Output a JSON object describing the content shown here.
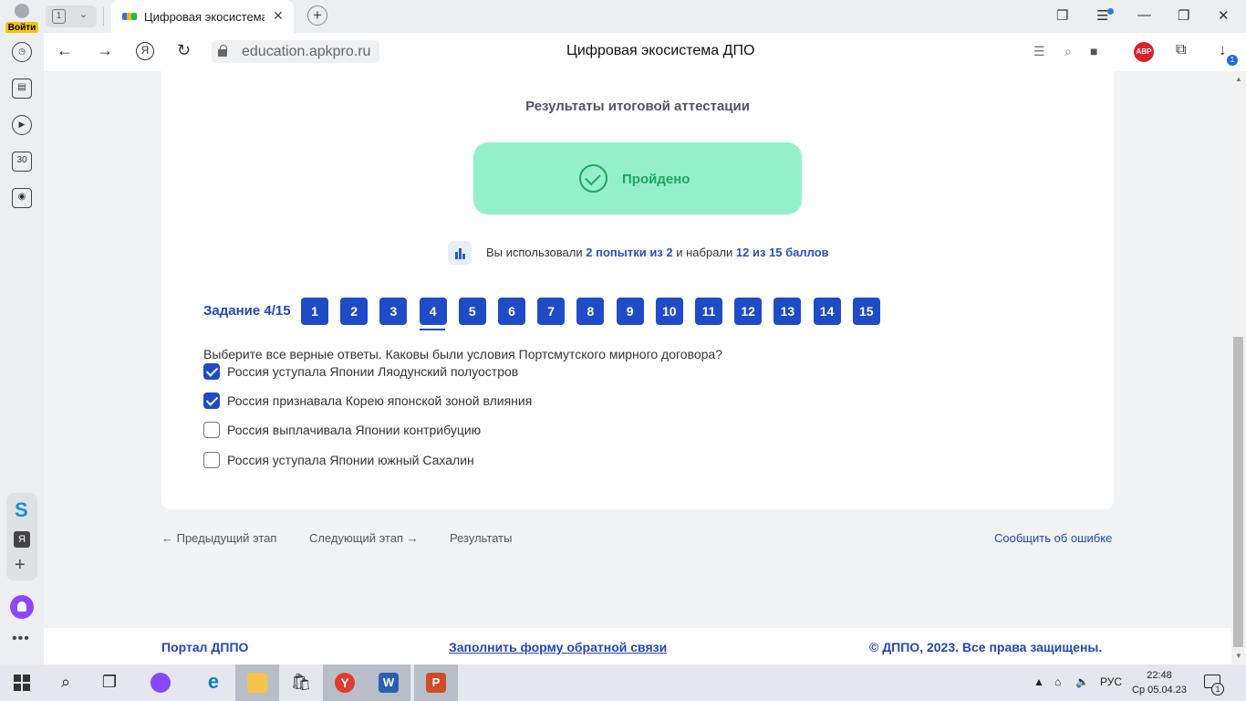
{
  "browser": {
    "login_label": "Войти",
    "tab_count": "1",
    "tab_title": "Цифровая экосистема ДПО",
    "url": "education.apkpro.ru",
    "page_title": "Цифровая экосистема ДПО",
    "abp_label": "ABP",
    "downloads_badge": "1",
    "sidepanel_calendar": "30",
    "sidepanel_ya": "Я"
  },
  "results": {
    "title": "Результаты итоговой аттестации",
    "status": "Пройдено",
    "stats_prefix": "Вы использовали",
    "attempts": "2 попытки из 2",
    "stats_middle": "и набрали",
    "score": "12 из 15 баллов"
  },
  "task": {
    "label": "Задание 4/15",
    "current": 4,
    "numbers": [
      "1",
      "2",
      "3",
      "4",
      "5",
      "6",
      "7",
      "8",
      "9",
      "10",
      "11",
      "12",
      "13",
      "14",
      "15"
    ]
  },
  "question": {
    "text": "Выберите все верные ответы. Каковы были условия Портсмутского мирного договора?",
    "options": [
      {
        "text": "Россия уступала Японии Ляодунский полуостров",
        "checked": true
      },
      {
        "text": "Россия признавала Корею японской зоной влияния",
        "checked": true
      },
      {
        "text": "Россия выплачивала Японии контрибуцию",
        "checked": false
      },
      {
        "text": "Россия уступала Японии южный Сахалин",
        "checked": false
      }
    ]
  },
  "nav": {
    "prev": "← Предыдущий этап",
    "next": "Следующий этап →",
    "results": "Результаты",
    "report": "Сообщить об ошибке"
  },
  "footer": {
    "portal": "Портал ДППО",
    "feedback": "Заполнить форму обратной связи",
    "copyright": "© ДППО, 2023. Все права защищены."
  },
  "taskbar": {
    "lang": "РУС",
    "time": "22:48",
    "date": "Ср 05.04.23",
    "notifications": "1"
  },
  "colors": {
    "accent": "#1f4bc6",
    "passed_bg": "#94f0cb",
    "passed_text": "#1fa662"
  }
}
